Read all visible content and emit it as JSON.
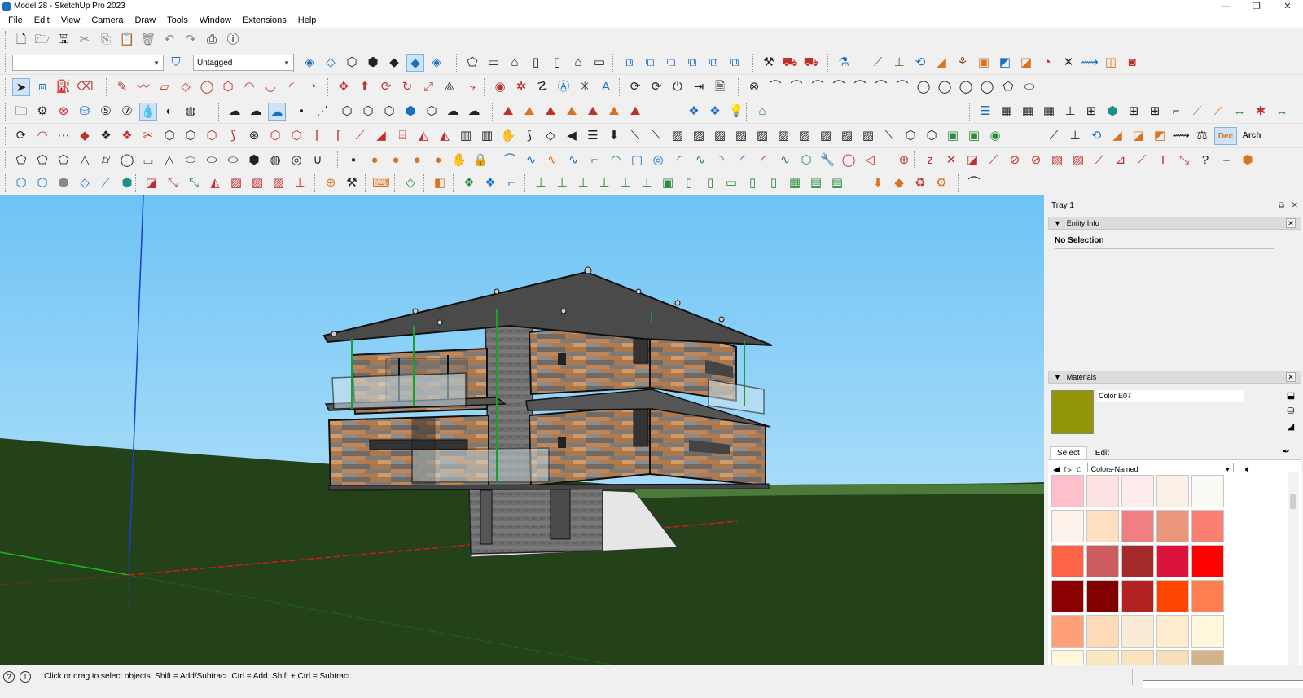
{
  "window": {
    "title": "Model 28 - SketchUp Pro 2023",
    "controls": [
      "—",
      "❐",
      "✕"
    ]
  },
  "menu": [
    "File",
    "Edit",
    "View",
    "Camera",
    "Draw",
    "Tools",
    "Window",
    "Extensions",
    "Help"
  ],
  "toolbars": {
    "row1": {
      "icons": [
        "new-icon",
        "open-icon",
        "save-icon",
        "cut-icon",
        "copy-icon",
        "paste-icon",
        "erase-icon",
        "undo-icon",
        "redo-icon",
        "print-icon",
        "model-info-icon"
      ]
    },
    "row2": {
      "style_dropdown_value": "",
      "tag_dropdown_value": "Untagged"
    },
    "row6_right_labels": [
      "Dec",
      "Arch"
    ]
  },
  "tray": {
    "title": "Tray 1",
    "entity_info": {
      "header": "Entity Info",
      "selection": "No Selection"
    },
    "materials": {
      "header": "Materials",
      "current_name": "Color E07",
      "current_color": "#94960a",
      "tabs": [
        "Select",
        "Edit"
      ],
      "active_tab": "Select",
      "library": "Colors-Named",
      "swatches": [
        "#ffc0cb",
        "#fde2e2",
        "#fdebee",
        "#faf0e6",
        "#fcfaf5",
        "#fdf2ea",
        "#fde0c0",
        "#f08080",
        "#e9967a",
        "#fa8072",
        "#ff6347",
        "#cd5c5c",
        "#a52a2a",
        "#dc143c",
        "#ff0000",
        "#8b0000",
        "#800000",
        "#b22222",
        "#ff4500",
        "#ff7f50",
        "#ffa07a",
        "#ffdab9",
        "#faebd7",
        "#ffebcd",
        "#fff8dc",
        "#fff8dc",
        "#fce8c0",
        "#fbe3bf",
        "#f6dfb8",
        "#d2b48c"
      ]
    }
  },
  "statusbar": {
    "message": "Click or drag to select objects. Shift = Add/Subtract. Ctrl = Add. Shift + Ctrl = Subtract."
  },
  "colors": {
    "sky_top": "#6ec3f5",
    "sky_bottom": "#bfe6fb",
    "ground": "#23421a"
  }
}
